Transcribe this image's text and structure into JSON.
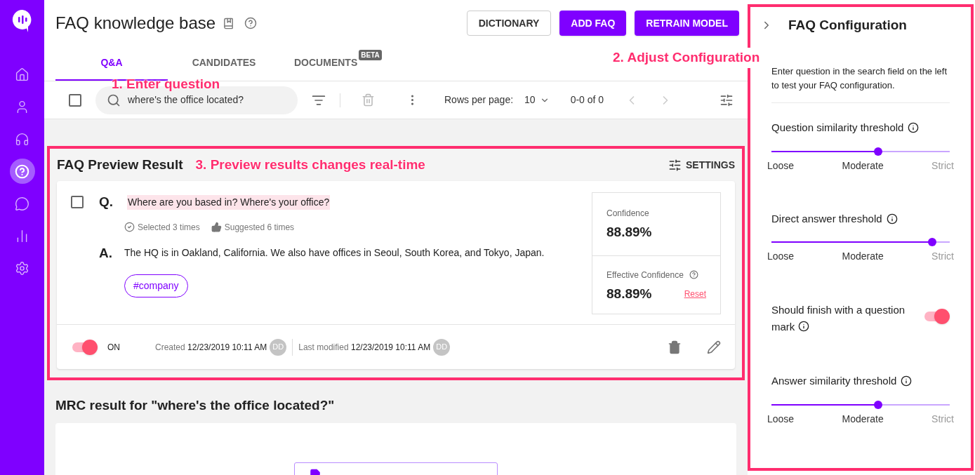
{
  "sidebar": {
    "items": [
      {
        "kind": "home",
        "selected": false
      },
      {
        "kind": "user",
        "selected": false
      },
      {
        "kind": "headset",
        "selected": false
      },
      {
        "kind": "faq",
        "selected": true
      },
      {
        "kind": "chat",
        "selected": false
      },
      {
        "kind": "chart",
        "selected": false
      },
      {
        "kind": "settings",
        "selected": false
      }
    ]
  },
  "header": {
    "title": "FAQ knowledge base",
    "buttons": [
      {
        "label": "DICTIONARY",
        "kind": "outlined"
      },
      {
        "label": "ADD FAQ",
        "kind": "filled"
      },
      {
        "label": "RETRAIN MODEL",
        "kind": "filled"
      }
    ]
  },
  "tabs": [
    {
      "label": "Q&A",
      "selected": true
    },
    {
      "label": "CANDIDATES",
      "selected": false
    },
    {
      "label": "DOCUMENTS",
      "selected": false,
      "badge": "BETA"
    }
  ],
  "toolbar": {
    "checked": false,
    "search": "where's the office located?",
    "annotation": "1. Enter question",
    "rows_label": "Rows per page:",
    "rows_value": "10",
    "range": "0-0 of 0"
  },
  "preview": {
    "title": "FAQ Preview Result",
    "annotation": "3. Preview results changes real-time",
    "settings_label": "SETTINGS",
    "faq": {
      "checked": false,
      "q_label": "Q.",
      "question": "Where are you based in? Where's your office?",
      "selected_count": "Selected 3 times",
      "suggested_count": "Suggested 6 times",
      "a_label": "A.",
      "answer": "The HQ is in Oakland, California. We also have offices in Seoul, South Korea, and Tokyo, Japan.",
      "tag": "#company",
      "confidence": {
        "label": "Confidence",
        "value": "88.89%"
      },
      "effective": {
        "label": "Effective Confidence",
        "value": "88.89%",
        "reset": "Reset"
      },
      "on": true,
      "status_label": "ON",
      "created_label": "Created",
      "created": "12/23/2019 10:11 AM",
      "created_by": "DD",
      "modified_label": "Last modified",
      "modified": "12/23/2019 10:11 AM",
      "modified_by": "DD"
    }
  },
  "mrc": {
    "title": "MRC result for \"where's the office located?\""
  },
  "config": {
    "title": "FAQ Configuration",
    "annotation": "2. Adjust Configuration",
    "description": "Enter question in the search field on the left to test your FAQ configuration.",
    "settings": [
      {
        "kind": "slider",
        "label": "Question similarity threshold",
        "level": 0.6,
        "ticks": [
          "Loose",
          "Moderate",
          "Strict"
        ]
      },
      {
        "kind": "slider",
        "label": "Direct answer threshold",
        "level": 0.9,
        "ticks": [
          "Loose",
          "Moderate",
          "Strict"
        ]
      },
      {
        "kind": "toggle",
        "label": "Should finish with a question mark",
        "on": true
      },
      {
        "kind": "slider",
        "label": "Answer similarity threshold",
        "level": 0.6,
        "ticks": [
          "Loose",
          "Moderate",
          "Strict"
        ]
      }
    ]
  }
}
